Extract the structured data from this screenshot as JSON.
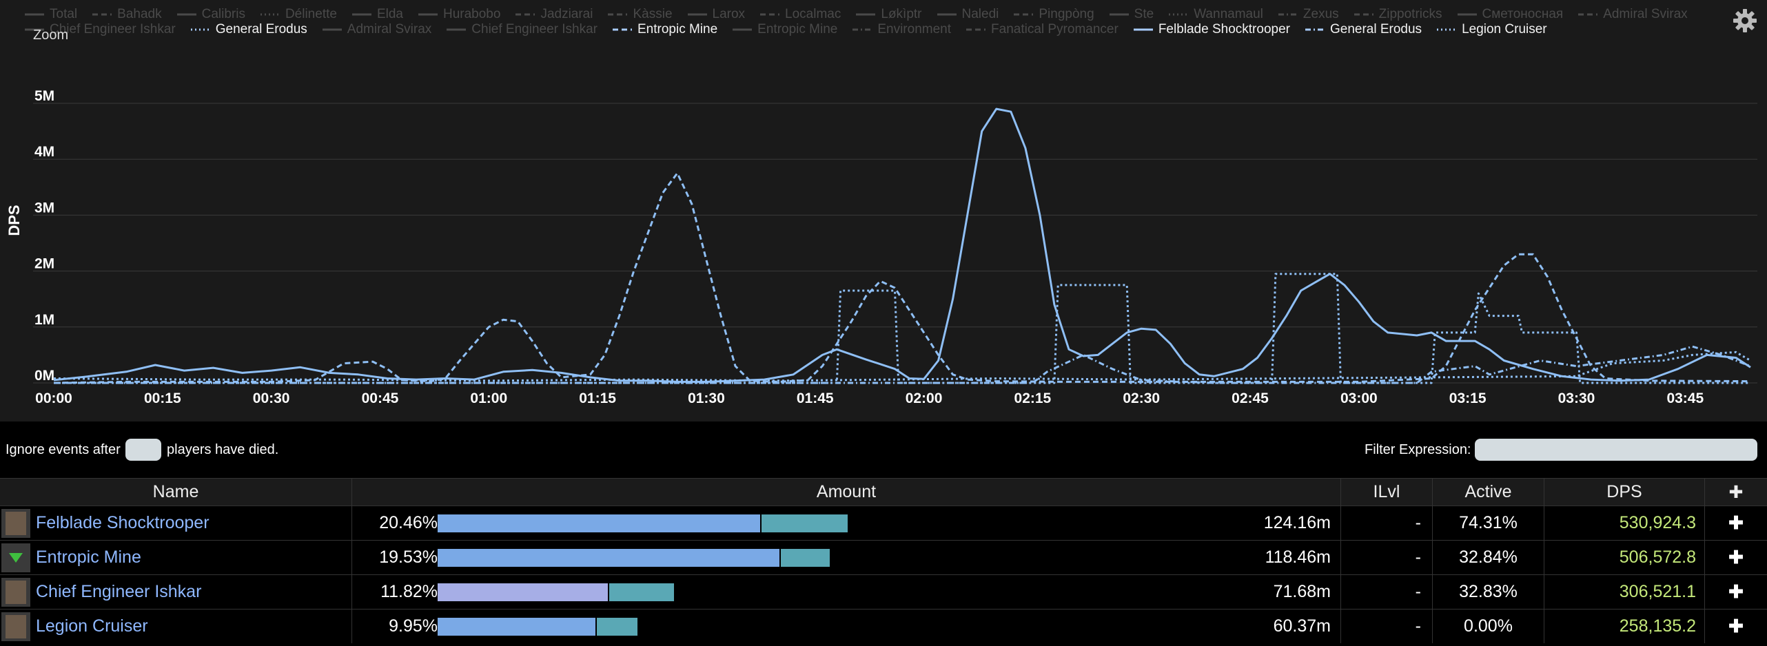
{
  "legend": {
    "row1": [
      {
        "name": "Total",
        "style": "solid",
        "on": false
      },
      {
        "name": "Bahadk",
        "style": "dash",
        "on": false
      },
      {
        "name": "Calibris",
        "style": "solid",
        "on": false
      },
      {
        "name": "Délinette",
        "style": "dot",
        "on": false
      },
      {
        "name": "Elda",
        "style": "solid",
        "on": false
      },
      {
        "name": "Hurabobo",
        "style": "solid",
        "on": false
      },
      {
        "name": "Jadziarai",
        "style": "dash",
        "on": false
      },
      {
        "name": "Kàssie",
        "style": "dash",
        "on": false
      },
      {
        "name": "Larox",
        "style": "solid",
        "on": false
      },
      {
        "name": "Localmac",
        "style": "dash",
        "on": false
      },
      {
        "name": "Løkìptr",
        "style": "solid",
        "on": false
      },
      {
        "name": "Naledi",
        "style": "solid",
        "on": false
      },
      {
        "name": "Pingpòng",
        "style": "dash",
        "on": false
      },
      {
        "name": "Ste",
        "style": "solid",
        "on": false
      },
      {
        "name": "Wannamaul",
        "style": "dot",
        "on": false
      },
      {
        "name": "Zexus",
        "style": "dashdot",
        "on": false
      },
      {
        "name": "Zippotricks",
        "style": "dash",
        "on": false
      },
      {
        "name": "Сметоносная",
        "style": "solid",
        "on": false
      },
      {
        "name": "Admiral Svirax",
        "style": "dash",
        "on": false
      }
    ],
    "row2": [
      {
        "name": "Chief Engineer Ishkar",
        "style": "solid",
        "on": false
      },
      {
        "name": "General Erodus",
        "style": "dot",
        "on": true
      },
      {
        "name": "Admiral Svirax",
        "style": "solid",
        "on": false
      },
      {
        "name": "Chief Engineer Ishkar",
        "style": "solid",
        "on": false
      },
      {
        "name": "Entropic Mine",
        "style": "dash",
        "on": true
      },
      {
        "name": "Entropic Mine",
        "style": "solid",
        "on": false
      },
      {
        "name": "Environment",
        "style": "dashdot",
        "on": false
      },
      {
        "name": "Fanatical Pyromancer",
        "style": "dash",
        "on": false
      },
      {
        "name": "Felblade Shocktrooper",
        "style": "solid",
        "on": true
      },
      {
        "name": "General Erodus",
        "style": "dashdot",
        "on": true
      },
      {
        "name": "Legion Cruiser",
        "style": "dot",
        "on": true
      }
    ]
  },
  "zoom_label": "Zoom",
  "chart_data": {
    "type": "line",
    "ylabel": "DPS",
    "ylim": [
      0,
      5000000
    ],
    "y_ticks": [
      "0M",
      "1M",
      "2M",
      "3M",
      "4M",
      "5M"
    ],
    "x_ticks": [
      "00:00",
      "00:15",
      "00:30",
      "00:45",
      "01:00",
      "01:15",
      "01:30",
      "01:45",
      "02:00",
      "02:15",
      "02:30",
      "02:45",
      "03:00",
      "03:15",
      "03:30",
      "03:45"
    ],
    "xlim_seconds": [
      0,
      234
    ],
    "series": [
      {
        "name": "Felblade Shocktrooper",
        "style": "solid",
        "points": [
          [
            0,
            50000
          ],
          [
            5,
            120000
          ],
          [
            10,
            200000
          ],
          [
            14,
            320000
          ],
          [
            18,
            220000
          ],
          [
            22,
            270000
          ],
          [
            26,
            180000
          ],
          [
            30,
            220000
          ],
          [
            34,
            280000
          ],
          [
            38,
            180000
          ],
          [
            42,
            150000
          ],
          [
            46,
            80000
          ],
          [
            50,
            60000
          ],
          [
            54,
            80000
          ],
          [
            58,
            60000
          ],
          [
            62,
            200000
          ],
          [
            66,
            230000
          ],
          [
            70,
            180000
          ],
          [
            74,
            100000
          ],
          [
            78,
            40000
          ],
          [
            82,
            40000
          ],
          [
            86,
            20000
          ],
          [
            90,
            20000
          ],
          [
            94,
            40000
          ],
          [
            98,
            60000
          ],
          [
            102,
            150000
          ],
          [
            106,
            500000
          ],
          [
            108,
            600000
          ],
          [
            112,
            420000
          ],
          [
            116,
            250000
          ],
          [
            118,
            80000
          ],
          [
            120,
            70000
          ],
          [
            122,
            400000
          ],
          [
            124,
            1500000
          ],
          [
            126,
            3000000
          ],
          [
            128,
            4500000
          ],
          [
            130,
            4900000
          ],
          [
            132,
            4850000
          ],
          [
            134,
            4200000
          ],
          [
            136,
            3000000
          ],
          [
            138,
            1400000
          ],
          [
            140,
            600000
          ],
          [
            142,
            480000
          ],
          [
            144,
            500000
          ],
          [
            146,
            700000
          ],
          [
            148,
            900000
          ],
          [
            150,
            970000
          ],
          [
            152,
            950000
          ],
          [
            154,
            700000
          ],
          [
            156,
            350000
          ],
          [
            158,
            150000
          ],
          [
            160,
            120000
          ],
          [
            164,
            250000
          ],
          [
            166,
            450000
          ],
          [
            168,
            800000
          ],
          [
            170,
            1200000
          ],
          [
            172,
            1650000
          ],
          [
            174,
            1800000
          ],
          [
            176,
            1950000
          ],
          [
            178,
            1750000
          ],
          [
            180,
            1450000
          ],
          [
            182,
            1100000
          ],
          [
            184,
            900000
          ],
          [
            188,
            850000
          ],
          [
            190,
            900000
          ],
          [
            192,
            750000
          ],
          [
            196,
            750000
          ],
          [
            198,
            600000
          ],
          [
            200,
            400000
          ],
          [
            204,
            250000
          ],
          [
            208,
            120000
          ],
          [
            212,
            60000
          ],
          [
            216,
            40000
          ],
          [
            220,
            60000
          ],
          [
            224,
            250000
          ],
          [
            228,
            500000
          ],
          [
            232,
            450000
          ],
          [
            234,
            280000
          ]
        ]
      },
      {
        "name": "Entropic Mine",
        "style": "dash",
        "points": [
          [
            0,
            0
          ],
          [
            10,
            20000
          ],
          [
            30,
            20000
          ],
          [
            36,
            50000
          ],
          [
            40,
            350000
          ],
          [
            44,
            380000
          ],
          [
            46,
            250000
          ],
          [
            48,
            50000
          ],
          [
            52,
            30000
          ],
          [
            54,
            80000
          ],
          [
            56,
            400000
          ],
          [
            58,
            700000
          ],
          [
            60,
            1000000
          ],
          [
            62,
            1130000
          ],
          [
            64,
            1100000
          ],
          [
            66,
            750000
          ],
          [
            68,
            350000
          ],
          [
            70,
            100000
          ],
          [
            74,
            150000
          ],
          [
            76,
            500000
          ],
          [
            78,
            1200000
          ],
          [
            80,
            2000000
          ],
          [
            82,
            2700000
          ],
          [
            84,
            3400000
          ],
          [
            86,
            3750000
          ],
          [
            88,
            3200000
          ],
          [
            90,
            2200000
          ],
          [
            92,
            1200000
          ],
          [
            94,
            300000
          ],
          [
            96,
            40000
          ],
          [
            100,
            20000
          ],
          [
            104,
            50000
          ],
          [
            106,
            300000
          ],
          [
            108,
            700000
          ],
          [
            110,
            1100000
          ],
          [
            112,
            1550000
          ],
          [
            114,
            1820000
          ],
          [
            116,
            1700000
          ],
          [
            118,
            1300000
          ],
          [
            120,
            900000
          ],
          [
            122,
            500000
          ],
          [
            124,
            150000
          ],
          [
            126,
            60000
          ],
          [
            130,
            30000
          ],
          [
            140,
            20000
          ],
          [
            150,
            20000
          ],
          [
            180,
            20000
          ],
          [
            190,
            80000
          ],
          [
            192,
            300000
          ],
          [
            194,
            800000
          ],
          [
            196,
            1300000
          ],
          [
            198,
            1700000
          ],
          [
            200,
            2100000
          ],
          [
            202,
            2300000
          ],
          [
            204,
            2300000
          ],
          [
            206,
            1900000
          ],
          [
            208,
            1300000
          ],
          [
            210,
            800000
          ],
          [
            212,
            300000
          ],
          [
            214,
            80000
          ],
          [
            220,
            40000
          ],
          [
            234,
            30000
          ]
        ]
      },
      {
        "name": "Legion Cruiser",
        "style": "dot",
        "points": [
          [
            0,
            0
          ],
          [
            108,
            0
          ],
          [
            108.5,
            1650000
          ],
          [
            116,
            1650000
          ],
          [
            116.5,
            0
          ],
          [
            138,
            0
          ],
          [
            138.5,
            1750000
          ],
          [
            148,
            1750000
          ],
          [
            148.5,
            0
          ],
          [
            168,
            0
          ],
          [
            168.5,
            1950000
          ],
          [
            177,
            1950000
          ],
          [
            177.5,
            0
          ],
          [
            190,
            0
          ],
          [
            190.5,
            900000
          ],
          [
            196,
            900000
          ],
          [
            196.5,
            1600000
          ],
          [
            198,
            1200000
          ],
          [
            202,
            1200000
          ],
          [
            202.5,
            900000
          ],
          [
            210,
            900000
          ],
          [
            210.5,
            0
          ],
          [
            234,
            0
          ]
        ]
      },
      {
        "name": "General Erodus",
        "style": "dashdot",
        "points": [
          [
            0,
            0
          ],
          [
            135,
            0
          ],
          [
            137,
            200000
          ],
          [
            142,
            500000
          ],
          [
            146,
            250000
          ],
          [
            150,
            50000
          ],
          [
            160,
            0
          ],
          [
            188,
            0
          ],
          [
            190,
            200000
          ],
          [
            196,
            300000
          ],
          [
            198,
            150000
          ],
          [
            205,
            400000
          ],
          [
            210,
            300000
          ],
          [
            216,
            400000
          ],
          [
            222,
            500000
          ],
          [
            226,
            650000
          ],
          [
            230,
            500000
          ],
          [
            234,
            300000
          ]
        ]
      },
      {
        "name": "General Erodus",
        "style": "dot",
        "points": [
          [
            0,
            80000
          ],
          [
            20,
            60000
          ],
          [
            40,
            60000
          ],
          [
            60,
            40000
          ],
          [
            80,
            60000
          ],
          [
            100,
            40000
          ],
          [
            130,
            80000
          ],
          [
            150,
            60000
          ],
          [
            170,
            80000
          ],
          [
            190,
            100000
          ],
          [
            210,
            120000
          ],
          [
            215,
            350000
          ],
          [
            222,
            400000
          ],
          [
            226,
            500000
          ],
          [
            232,
            550000
          ],
          [
            234,
            400000
          ]
        ]
      }
    ]
  },
  "controls": {
    "ignore_text_1": "Ignore events after",
    "players_value": "",
    "ignore_text_2": "players have died.",
    "filter_label": "Filter Expression:",
    "filter_value": ""
  },
  "table": {
    "headers": {
      "name": "Name",
      "amount": "Amount",
      "ilvl": "ILvl",
      "active": "Active",
      "dps": "DPS",
      "plus": "✚"
    },
    "rows": [
      {
        "name": "Felblade Shocktrooper",
        "pct": "20.46%",
        "bar1_frac": 0.397,
        "bar2_frac": 0.106,
        "bar1_color": "#7aa9e6",
        "amount": "124.16m",
        "ilvl": "-",
        "active": "74.31%",
        "dps": "530,924.3",
        "plus": "✚"
      },
      {
        "name": "Entropic Mine",
        "pct": "19.53%",
        "bar1_frac": 0.42,
        "bar2_frac": 0.06,
        "bar1_color": "#7aa9e6",
        "amount": "118.46m",
        "ilvl": "-",
        "active": "32.84%",
        "dps": "506,572.8",
        "plus": "✚"
      },
      {
        "name": "Chief Engineer Ishkar",
        "pct": "11.82%",
        "bar1_frac": 0.209,
        "bar2_frac": 0.08,
        "bar1_color": "#a6aee6",
        "amount": "71.68m",
        "ilvl": "-",
        "active": "32.83%",
        "dps": "306,521.1",
        "plus": "✚"
      },
      {
        "name": "Legion Cruiser",
        "pct": "9.95%",
        "bar1_frac": 0.194,
        "bar2_frac": 0.05,
        "bar1_color": "#7aa9e6",
        "amount": "60.37m",
        "ilvl": "-",
        "active": "0.00%",
        "dps": "258,135.2",
        "plus": "✚"
      }
    ]
  }
}
